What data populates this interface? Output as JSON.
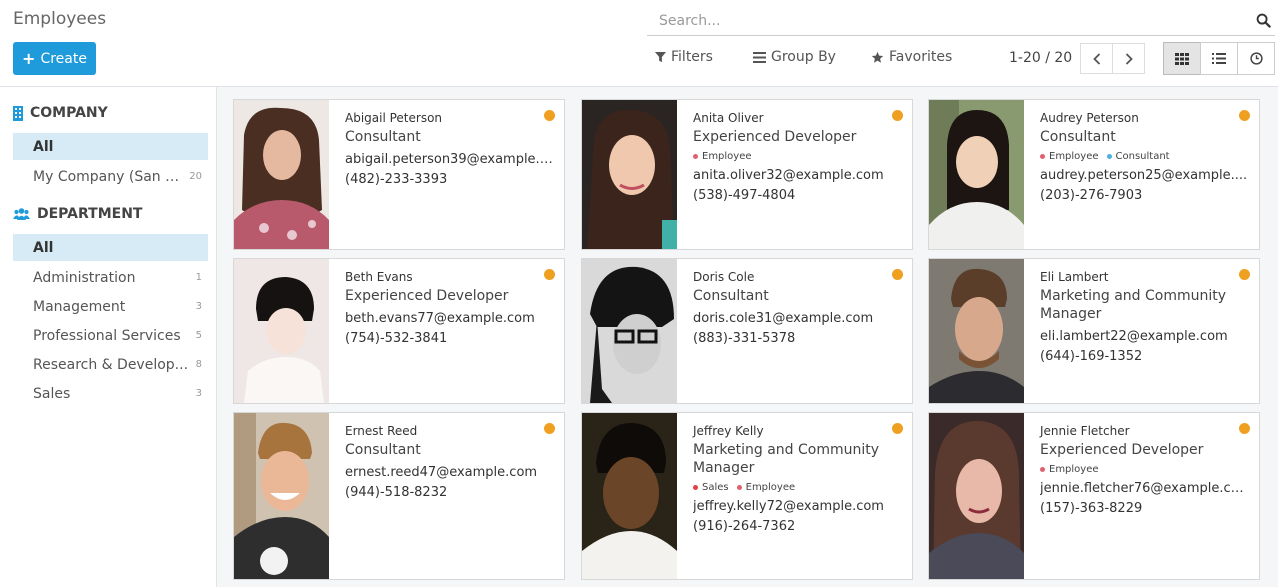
{
  "header": {
    "title": "Employees",
    "create_label": "Create",
    "search_placeholder": "Search...",
    "filters_label": "Filters",
    "groupby_label": "Group By",
    "favorites_label": "Favorites",
    "pager": "1-20 / 20"
  },
  "sidebar": {
    "company_title": "COMPANY",
    "company_items": [
      {
        "label": "All",
        "count": ""
      },
      {
        "label": "My Company (San F...",
        "count": "20"
      }
    ],
    "department_title": "DEPARTMENT",
    "department_items": [
      {
        "label": "All",
        "count": ""
      },
      {
        "label": "Administration",
        "count": "1"
      },
      {
        "label": "Management",
        "count": "3"
      },
      {
        "label": "Professional Services",
        "count": "5"
      },
      {
        "label": "Research & Develop...",
        "count": "8"
      },
      {
        "label": "Sales",
        "count": "3"
      }
    ]
  },
  "colors": {
    "accent": "#1f9bdc",
    "status": "#f0a020",
    "tag_employee": "#e06070",
    "tag_consultant": "#4ab0e0",
    "tag_sales": "#e04040"
  },
  "employees": [
    {
      "name": "Abigail Peterson",
      "job": "Consultant",
      "tags": [],
      "email": "abigail.peterson39@example.c...",
      "phone": "(482)-233-3393"
    },
    {
      "name": "Anita Oliver",
      "job": "Experienced Developer",
      "tags": [
        "Employee"
      ],
      "email": "anita.oliver32@example.com",
      "phone": "(538)-497-4804"
    },
    {
      "name": "Audrey Peterson",
      "job": "Consultant",
      "tags": [
        "Employee",
        "Consultant"
      ],
      "email": "audrey.peterson25@example....",
      "phone": "(203)-276-7903"
    },
    {
      "name": "Beth Evans",
      "job": "Experienced Developer",
      "tags": [],
      "email": "beth.evans77@example.com",
      "phone": "(754)-532-3841"
    },
    {
      "name": "Doris Cole",
      "job": "Consultant",
      "tags": [],
      "email": "doris.cole31@example.com",
      "phone": "(883)-331-5378"
    },
    {
      "name": "Eli Lambert",
      "job": "Marketing and Community Manager",
      "tags": [],
      "email": "eli.lambert22@example.com",
      "phone": "(644)-169-1352"
    },
    {
      "name": "Ernest Reed",
      "job": "Consultant",
      "tags": [],
      "email": "ernest.reed47@example.com",
      "phone": "(944)-518-8232"
    },
    {
      "name": "Jeffrey Kelly",
      "job": "Marketing and Community Manager",
      "tags": [
        "Sales",
        "Employee"
      ],
      "email": "jeffrey.kelly72@example.com",
      "phone": "(916)-264-7362"
    },
    {
      "name": "Jennie Fletcher",
      "job": "Experienced Developer",
      "tags": [
        "Employee"
      ],
      "email": "jennie.fletcher76@example.com",
      "phone": "(157)-363-8229"
    }
  ]
}
